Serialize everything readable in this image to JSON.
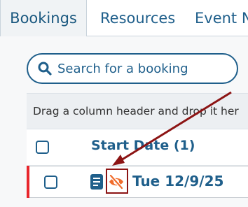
{
  "tabs": [
    {
      "label": "Bookings"
    },
    {
      "label": "Resources"
    },
    {
      "label": "Event N"
    }
  ],
  "search": {
    "placeholder": "Search for a booking"
  },
  "group_bar": {
    "text": "Drag a column header and drop it her"
  },
  "grid": {
    "header": {
      "start_date": "Start Date (1)"
    },
    "row": {
      "date": "Tue 12/9/25"
    }
  },
  "colors": {
    "primary": "#1f5f8b",
    "hidden_icon": "#f06c2c",
    "row_accent": "#e8262c",
    "annotation": "#8c1414"
  },
  "icons": [
    "search-icon",
    "document-icon",
    "hidden-eye-icon",
    "annotation-arrow"
  ]
}
